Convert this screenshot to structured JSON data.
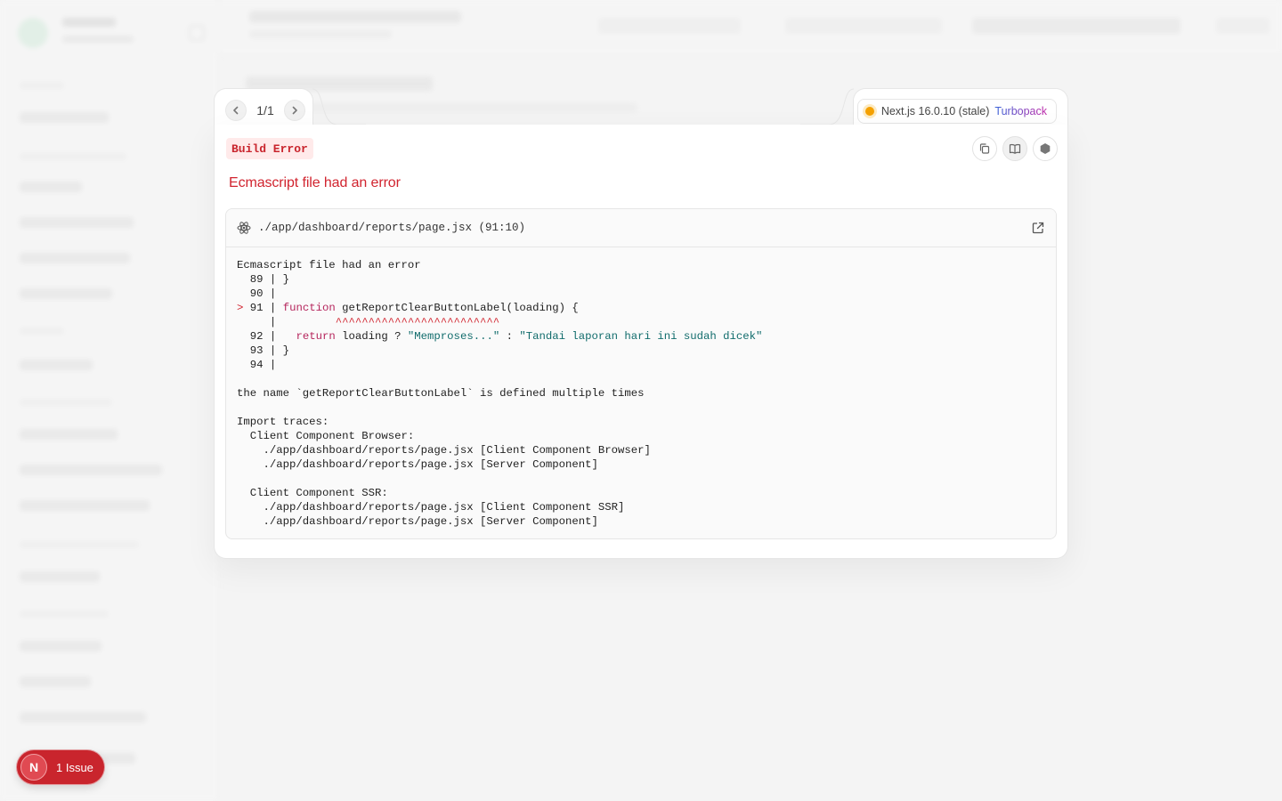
{
  "pager": {
    "count": "1/1",
    "prev_icon": "chevron-left-icon",
    "next_icon": "chevron-right-icon"
  },
  "version": {
    "label": "Next.js 16.0.10 (stale)",
    "bundler": "Turbopack",
    "status_color": "#f5a100"
  },
  "error": {
    "label": "Build Error",
    "title": "Ecmascript file had an error",
    "file_path": "./app/dashboard/reports/page.jsx (91:10)"
  },
  "tools": {
    "copy_icon": "copy-icon",
    "docs_icon": "book-icon",
    "nextjs_icon": "hexagon-icon"
  },
  "code": {
    "heading": "Ecmascript file had an error",
    "lines": [
      {
        "marker": " ",
        "num": "89",
        "content": "}"
      },
      {
        "marker": " ",
        "num": "90",
        "content": ""
      },
      {
        "marker": ">",
        "num": "91",
        "kw": "function",
        "content": " getReportClearButtonLabel(loading) {"
      },
      {
        "marker": " ",
        "num": "",
        "caret": "^^^^^^^^^^^^^^^^^^^^^^^^^"
      },
      {
        "marker": " ",
        "num": "92",
        "kw": "return",
        "content_before": "  ",
        "content_after": " loading ? ",
        "str1": "\"Memproses...\"",
        "mid": " : ",
        "str2": "\"Tandai laporan hari ini sudah dicek\""
      },
      {
        "marker": " ",
        "num": "93",
        "content": "}"
      },
      {
        "marker": " ",
        "num": "94",
        "content": ""
      }
    ],
    "message": "the name `getReportClearButtonLabel` is defined multiple times",
    "traces_title": "Import traces:",
    "browser_title": "Client Component Browser:",
    "browser_1": "./app/dashboard/reports/page.jsx [Client Component Browser]",
    "browser_2": "./app/dashboard/reports/page.jsx [Server Component]",
    "ssr_title": "Client Component SSR:",
    "ssr_1": "./app/dashboard/reports/page.jsx [Client Component SSR]",
    "ssr_2": "./app/dashboard/reports/page.jsx [Server Component]"
  },
  "issues": {
    "avatar": "N",
    "label": "1 Issue",
    "color": "#c9252d"
  }
}
